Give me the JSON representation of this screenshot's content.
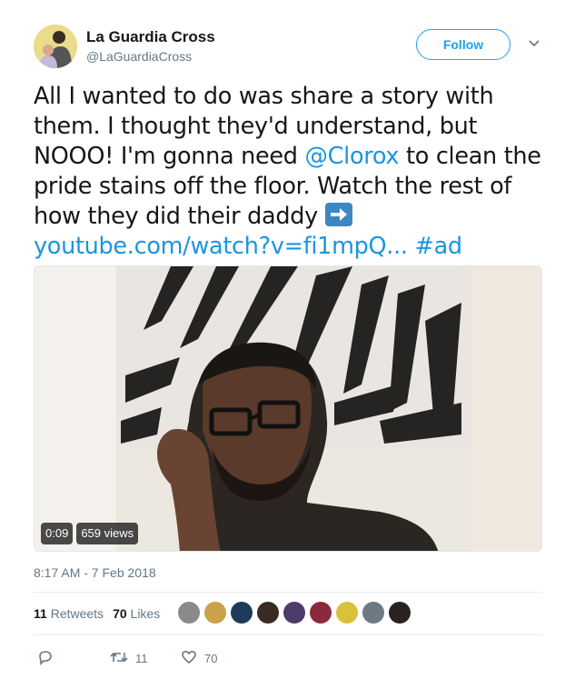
{
  "author": {
    "name": "La Guardia Cross",
    "handle": "@LaGuardiaCross",
    "avatar_icon": "profile-photo-icon"
  },
  "follow_label": "Follow",
  "tweet": {
    "line1": "All I wanted to do was share a story with",
    "line2": "them. I thought they'd understand, but",
    "line3_pre": "NOOO! I'm gonna need ",
    "mention": "@Clorox",
    "line3_post": " to clean the",
    "line4": "pride stains off the floor. Watch the rest of",
    "line5": "how they did their daddy ",
    "arrow_emoji": "right-arrow-emoji",
    "url": "youtube.com/watch?v=fi1mpQ...",
    "hashtag": "#ad"
  },
  "video": {
    "duration": "0:09",
    "views": "659 views"
  },
  "timestamp": "8:17 AM - 7 Feb 2018",
  "stats": {
    "retweets_count": "11",
    "retweets_label": "Retweets",
    "likes_count": "70",
    "likes_label": "Likes"
  },
  "likers": [
    {
      "color": "#8a8a8a"
    },
    {
      "color": "#c9a24a"
    },
    {
      "color": "#1f3a5a"
    },
    {
      "color": "#3a2a22"
    },
    {
      "color": "#4d3b6a"
    },
    {
      "color": "#8a2a3a"
    },
    {
      "color": "#d8c23a"
    },
    {
      "color": "#6c7a86"
    },
    {
      "color": "#2a2220"
    }
  ],
  "actions": {
    "reply_count": "",
    "retweet_count": "11",
    "like_count": "70"
  },
  "colors": {
    "accent": "#1da1f2",
    "link": "#1b95e0",
    "secondary_text": "#657786"
  }
}
